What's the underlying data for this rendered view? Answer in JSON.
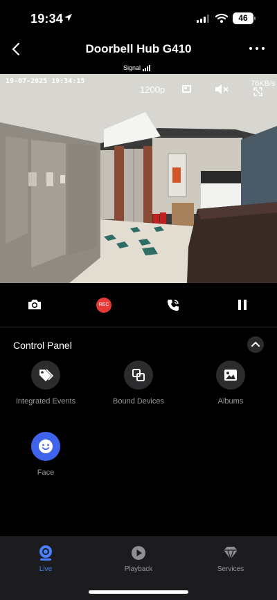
{
  "status_bar": {
    "time": "19:34",
    "battery": "46",
    "icons": [
      "location-arrow-icon",
      "cellular-signal-icon",
      "wifi-icon",
      "battery-icon"
    ]
  },
  "nav": {
    "title": "Doorbell Hub G410",
    "icons": [
      "back-chevron-icon",
      "more-icon"
    ]
  },
  "signal": {
    "label": "Signal",
    "bars": 4
  },
  "video": {
    "timestamp": "19-07-2025 19:34:15",
    "resolution": "1200p",
    "data_rate": "76KB/s",
    "icons": [
      "split-view-icon",
      "mute-icon",
      "fullscreen-icon"
    ]
  },
  "controls": {
    "rec_label": "REC",
    "icons": [
      "camera-icon",
      "record-icon",
      "intercom-phone-icon",
      "pause-icon"
    ],
    "rec_color": "#e53935"
  },
  "control_panel": {
    "title": "Control Panel",
    "features": [
      {
        "label": "Integrated Events",
        "icon": "tags-icon"
      },
      {
        "label": "Bound Devices",
        "icon": "linked-squares-icon"
      },
      {
        "label": "Albums",
        "icon": "image-icon"
      },
      {
        "label": "Face",
        "icon": "smiley-face-icon"
      }
    ]
  },
  "tabbar": {
    "tabs": [
      {
        "label": "Live",
        "icon": "live-camera-icon",
        "active": true
      },
      {
        "label": "Playback",
        "icon": "play-circle-icon",
        "active": false
      },
      {
        "label": "Services",
        "icon": "diamond-icon",
        "active": false
      }
    ]
  },
  "colors": {
    "accent": "#4a80ff",
    "face_button": "#3f63ea",
    "background": "#000000",
    "tabbar": "#1c1c1e"
  }
}
